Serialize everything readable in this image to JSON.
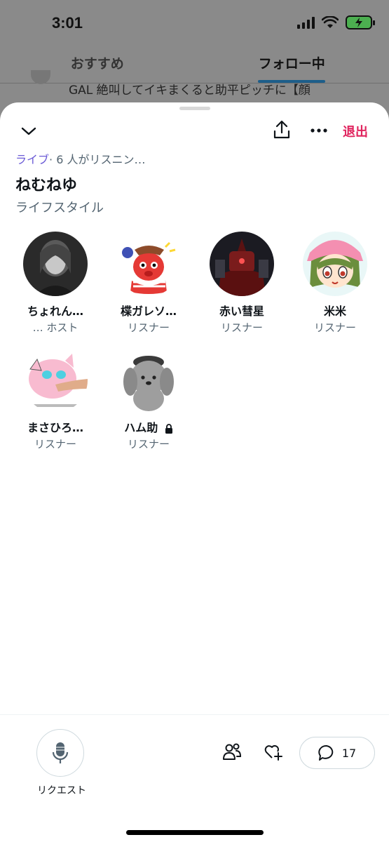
{
  "status_bar": {
    "time": "3:01"
  },
  "background": {
    "tabs": [
      {
        "label": "おすすめ",
        "active": false
      },
      {
        "label": "フォロー中",
        "active": true
      }
    ],
    "post_snippet": "GAL 絶叫してイキまくると助平ピッチに【顔"
  },
  "space": {
    "header": {
      "leave_label": "退出"
    },
    "live_label": "ライブ",
    "listening_text": "· 6 人がリスニン…",
    "title": "ねむねゆ",
    "category": "ライフスタイル",
    "participants": [
      {
        "name": "ちょれん…",
        "role": "… ホスト",
        "avatar": "photo-avatar"
      },
      {
        "name": "楪ガレソ…",
        "role": "リスナー",
        "avatar": "octopus-avatar"
      },
      {
        "name": "赤い彗星",
        "role": "リスナー",
        "avatar": "robot-avatar"
      },
      {
        "name": "米米",
        "role": "リスナー",
        "avatar": "anime-avatar"
      },
      {
        "name": "まさひろ…",
        "role": "リスナー",
        "avatar": "pink-plush-avatar"
      },
      {
        "name": "ハム助",
        "role": "リスナー",
        "avatar": "dog-plush-avatar",
        "locked": true
      }
    ],
    "footer": {
      "request_label": "リクエスト",
      "comment_count": "17"
    }
  },
  "colors": {
    "leave": "#e0245e",
    "live": "#6b5bd6",
    "tab_indicator": "#1d5e8a"
  }
}
